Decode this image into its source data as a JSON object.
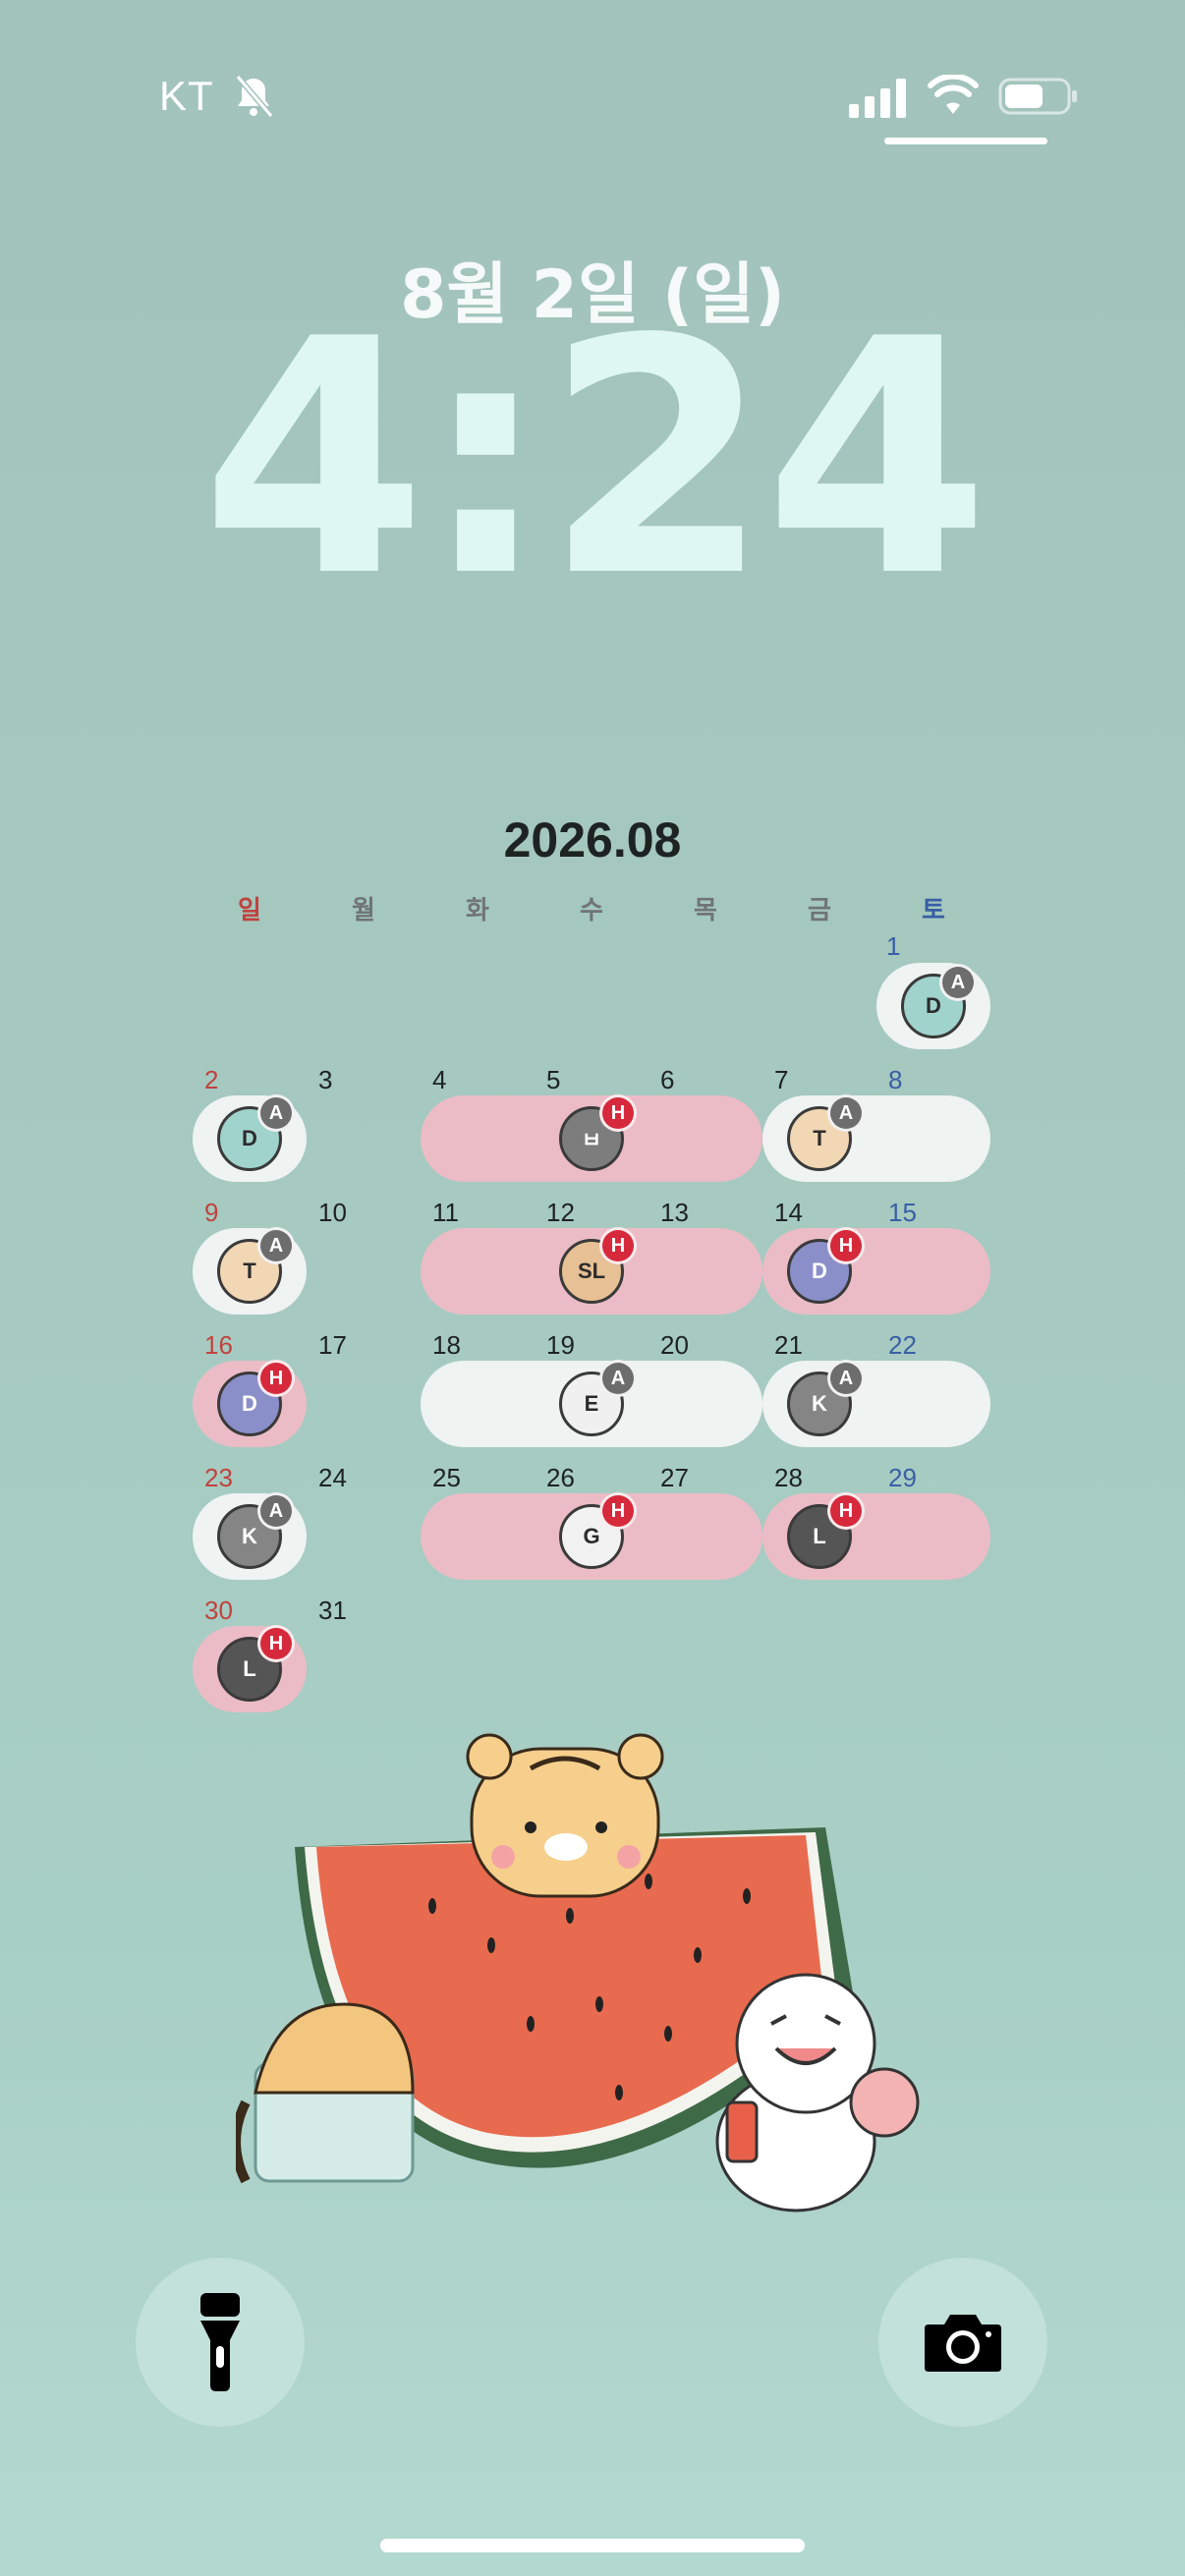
{
  "status_bar": {
    "carrier": "KT"
  },
  "lock_screen": {
    "date": "8월 2일 (일)",
    "time": "4:24"
  },
  "calendar": {
    "title": "2026.08",
    "weekdays": [
      "일",
      "월",
      "화",
      "수",
      "목",
      "금",
      "토"
    ],
    "days": [
      {
        "n": "1"
      },
      {
        "n": "2"
      },
      {
        "n": "3"
      },
      {
        "n": "4"
      },
      {
        "n": "5"
      },
      {
        "n": "6"
      },
      {
        "n": "7"
      },
      {
        "n": "8"
      },
      {
        "n": "9"
      },
      {
        "n": "10"
      },
      {
        "n": "11"
      },
      {
        "n": "12"
      },
      {
        "n": "13"
      },
      {
        "n": "14"
      },
      {
        "n": "15"
      },
      {
        "n": "16"
      },
      {
        "n": "17"
      },
      {
        "n": "18"
      },
      {
        "n": "19"
      },
      {
        "n": "20"
      },
      {
        "n": "21"
      },
      {
        "n": "22"
      },
      {
        "n": "23"
      },
      {
        "n": "24"
      },
      {
        "n": "25"
      },
      {
        "n": "26"
      },
      {
        "n": "27"
      },
      {
        "n": "28"
      },
      {
        "n": "29"
      },
      {
        "n": "30"
      },
      {
        "n": "31"
      }
    ],
    "series": [
      {
        "letter": "D",
        "color": "#9fd3cc",
        "badge": "A"
      },
      {
        "letter": "D",
        "color": "#9fd3cc",
        "badge": "A"
      },
      {
        "letter": "ㅂ",
        "color": "#7d7d7d",
        "badge": "H"
      },
      {
        "letter": "T",
        "color": "#f2d7b5",
        "badge": "A"
      },
      {
        "letter": "T",
        "color": "#f2d7b5",
        "badge": "A"
      },
      {
        "letter": "SL",
        "color": "#e7c095",
        "badge": "H"
      },
      {
        "letter": "D",
        "color": "#8b8fc9",
        "badge": "H"
      },
      {
        "letter": "D",
        "color": "#8b8fc9",
        "badge": "H"
      },
      {
        "letter": "E",
        "color": "#f0f0f0",
        "badge": "A"
      },
      {
        "letter": "K",
        "color": "#858585",
        "badge": "A"
      },
      {
        "letter": "K",
        "color": "#858585",
        "badge": "A"
      },
      {
        "letter": "G",
        "color": "#f2f2f2",
        "badge": "H"
      },
      {
        "letter": "L",
        "color": "#555555",
        "badge": "H"
      },
      {
        "letter": "L",
        "color": "#555555",
        "badge": "H"
      }
    ]
  },
  "buttons": {
    "flashlight": "flashlight-icon",
    "camera": "camera-icon"
  }
}
